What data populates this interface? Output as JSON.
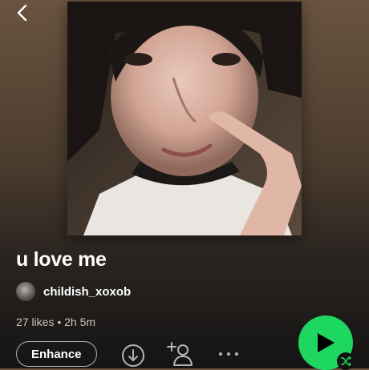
{
  "playlist": {
    "title": "u love me",
    "owner": "childish_xoxob",
    "meta": "27 likes • 2h 5m"
  },
  "actions": {
    "enhance_label": "Enhance",
    "more_label": "···"
  },
  "icons": {
    "back": "chevron-left-icon",
    "download": "download-icon",
    "add_user": "add-user-icon",
    "more": "more-icon",
    "play": "play-icon",
    "shuffle": "shuffle-icon"
  },
  "colors": {
    "accent": "#1ed760",
    "background_top": "#6a5440",
    "background_bottom": "#141414",
    "secondary_text": "#c9c4bf"
  }
}
